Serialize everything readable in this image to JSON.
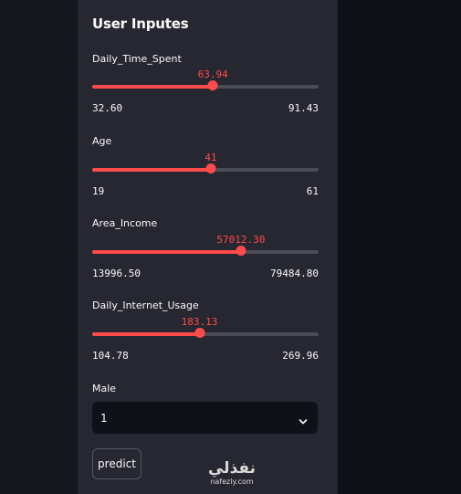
{
  "sidebar": {
    "title": "User Inputes",
    "sliders": [
      {
        "label": "Daily_Time_Spent",
        "value": "63.94",
        "min": "32.60",
        "max": "91.43",
        "fraction": 0.533
      },
      {
        "label": "Age",
        "value": "41",
        "min": "19",
        "max": "61",
        "fraction": 0.524
      },
      {
        "label": "Area_Income",
        "value": "57012.30",
        "min": "13996.50",
        "max": "79484.80",
        "fraction": 0.657
      },
      {
        "label": "Daily_Internet_Usage",
        "value": "183.13",
        "min": "104.78",
        "max": "269.96",
        "fraction": 0.474
      }
    ],
    "select": {
      "label": "Male",
      "value": "1"
    },
    "button": {
      "label": "predict"
    }
  },
  "watermark": {
    "logo": "نفذلي",
    "url": "nafezly.com"
  },
  "colors": {
    "accent": "#ff4b4b",
    "sidebar_bg": "#262730",
    "main_bg": "#0e1117",
    "text": "#fafafa"
  },
  "icons": {
    "select_chevron": "chevron-down-icon"
  }
}
